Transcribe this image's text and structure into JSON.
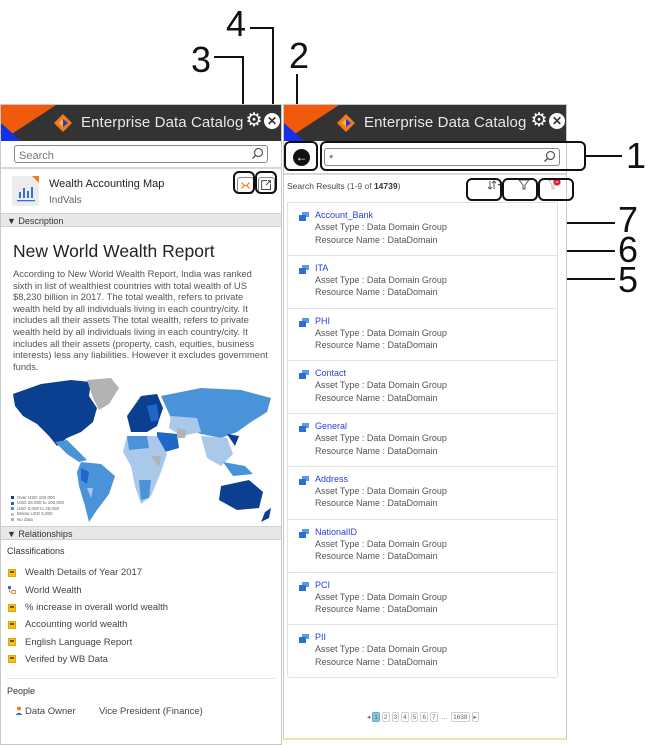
{
  "callouts": [
    "1",
    "2",
    "3",
    "4",
    "5",
    "6",
    "7"
  ],
  "left_panel": {
    "header": {
      "title": "Enterprise Data Catalog",
      "settings_icon": "gear-icon",
      "close_icon": "close-icon"
    },
    "search": {
      "placeholder": "Search",
      "value": ""
    },
    "asset": {
      "name": "Wealth Accounting Map",
      "subtitle": "IndVals",
      "icon": "report-chart-icon"
    },
    "actions": {
      "lineage_icon": "lineage-impact-icon",
      "open_icon": "open-external-icon"
    },
    "description": {
      "section_label": "▼ Description",
      "title": "New World Wealth Report",
      "text": "According to New World Wealth Report, India was ranked sixth in list of wealthiest countries with total wealth of US $8,230 billion in 2017. The total wealth, refers to private wealth held by all individuals living in each country/city. It includes all their assets The total wealth, refers to private wealth held by all individuals living in each country/city. It includes all their assets (property, cash, equities, business interests) less any liabilities. However it excludes government funds.",
      "map_legend": [
        {
          "label": "Over USD 100,000",
          "color": "#0b3f8f"
        },
        {
          "label": "USD 25,000 to 100,000",
          "color": "#1f67c8"
        },
        {
          "label": "USD 5,000 to 25,000",
          "color": "#4a93d8"
        },
        {
          "label": "Below USD 5,000",
          "color": "#a9c8ea"
        },
        {
          "label": "No data",
          "color": "#b3b3b3"
        }
      ]
    },
    "relationships": {
      "section_label": "▼ Relationships",
      "classifications_heading": "Classifications",
      "classifications": [
        {
          "label": "Wealth Details of Year 2017",
          "icon": "business-term-icon"
        },
        {
          "label": "World Wealth",
          "icon": "category-icon"
        },
        {
          "label": "% increase in overall world wealth",
          "icon": "business-term-icon"
        },
        {
          "label": "Accounting world wealth",
          "icon": "business-term-icon"
        },
        {
          "label": "English Language Report",
          "icon": "business-term-icon"
        },
        {
          "label": "Verifed by WB Data",
          "icon": "business-term-icon"
        }
      ],
      "people_heading": "People",
      "people": [
        {
          "role": "Data Owner",
          "name": "Vice President (Finance)"
        }
      ]
    }
  },
  "right_panel": {
    "header": {
      "title": "Enterprise Data Catalog"
    },
    "search": {
      "value": "*"
    },
    "results_summary": {
      "label": "Search Results",
      "range": "(1-9 of ",
      "total": "14739",
      "suffix": ")"
    },
    "toolbar": {
      "sort_icon": "sort-icon",
      "filter_icon": "filter-icon",
      "clear_filter_icon": "clear-filter-icon"
    },
    "results": [
      {
        "name": "Account_Bank",
        "asset_type": "Asset Type : Data Domain Group",
        "resource": "Resource Name : DataDomain"
      },
      {
        "name": "ITA",
        "asset_type": "Asset Type : Data Domain Group",
        "resource": "Resource Name : DataDomain"
      },
      {
        "name": "PHI",
        "asset_type": "Asset Type : Data Domain Group",
        "resource": "Resource Name : DataDomain"
      },
      {
        "name": "Contact",
        "asset_type": "Asset Type : Data Domain Group",
        "resource": "Resource Name : DataDomain"
      },
      {
        "name": "General",
        "asset_type": "Asset Type : Data Domain Group",
        "resource": "Resource Name : DataDomain"
      },
      {
        "name": "Address",
        "asset_type": "Asset Type : Data Domain Group",
        "resource": "Resource Name : DataDomain"
      },
      {
        "name": "NationalID",
        "asset_type": "Asset Type : Data Domain Group",
        "resource": "Resource Name : DataDomain"
      },
      {
        "name": "PCI",
        "asset_type": "Asset Type : Data Domain Group",
        "resource": "Resource Name : DataDomain"
      },
      {
        "name": "PII",
        "asset_type": "Asset Type : Data Domain Group",
        "resource": "Resource Name : DataDomain"
      }
    ],
    "pagination": {
      "prev": "◂",
      "pages": [
        "1",
        "2",
        "3",
        "4",
        "5",
        "6",
        "7"
      ],
      "current": "1",
      "ellipsis": "...",
      "last": "1638",
      "next": "▸"
    }
  }
}
